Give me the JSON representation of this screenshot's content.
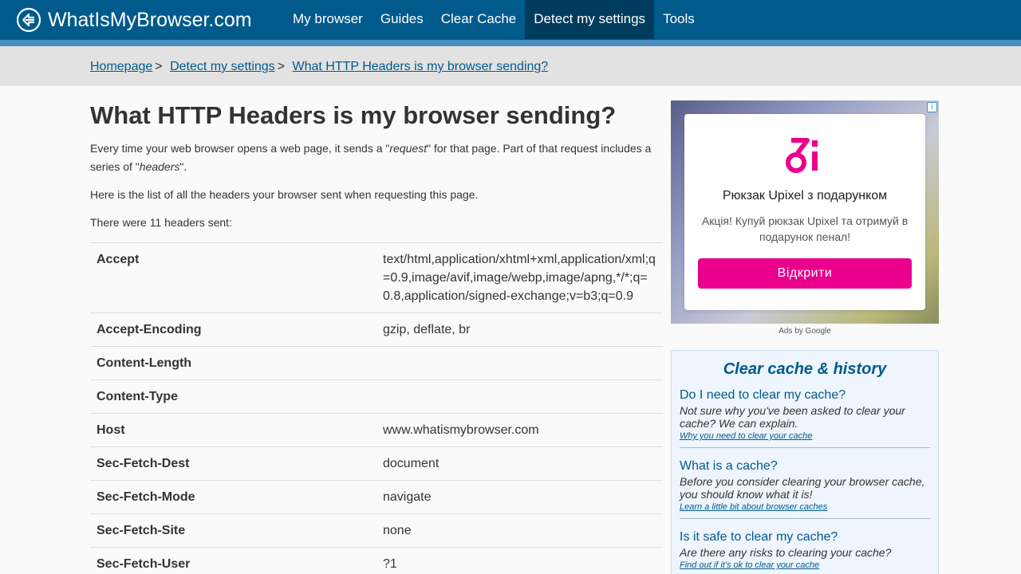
{
  "header": {
    "logo_text": "WhatIsMyBrowser.com",
    "nav": [
      {
        "label": "My browser"
      },
      {
        "label": "Guides"
      },
      {
        "label": "Clear Cache"
      },
      {
        "label": "Detect my settings",
        "active": true
      },
      {
        "label": "Tools"
      }
    ]
  },
  "breadcrumb": {
    "items": [
      "Homepage",
      "Detect my settings",
      "What HTTP Headers is my browser sending?"
    ],
    "separator": ">"
  },
  "main": {
    "title": "What HTTP Headers is my browser sending?",
    "intro_1": "Every time your web browser opens a web page, it sends a \"",
    "intro_em1": "request",
    "intro_2": "\" for that page. Part of that request includes a series of \"",
    "intro_em2": "headers",
    "intro_3": "\".",
    "list_text": "Here is the list of all the headers your browser sent when requesting this page.",
    "count_text": "There were 11 headers sent:",
    "headers": [
      {
        "name": "Accept",
        "value": "text/html,application/xhtml+xml,application/xml;q=0.9,image/avif,image/webp,image/apng,*/*;q=0.8,application/signed-exchange;v=b3;q=0.9"
      },
      {
        "name": "Accept-Encoding",
        "value": "gzip, deflate, br"
      },
      {
        "name": "Content-Length",
        "value": ""
      },
      {
        "name": "Content-Type",
        "value": ""
      },
      {
        "name": "Host",
        "value": "www.whatismybrowser.com"
      },
      {
        "name": "Sec-Fetch-Dest",
        "value": "document"
      },
      {
        "name": "Sec-Fetch-Mode",
        "value": "navigate"
      },
      {
        "name": "Sec-Fetch-Site",
        "value": "none"
      },
      {
        "name": "Sec-Fetch-User",
        "value": "?1"
      }
    ]
  },
  "ad": {
    "title": "Рюкзак Upixel з подарунком",
    "description": "Акція! Купуй рюкзак Upixel та отримуй в подарунок пенал!",
    "button": "Відкрити",
    "info_icon": "i",
    "ads_by": "Ads by Google",
    "brand_color": "#ea008c"
  },
  "cache_box": {
    "title": "Clear cache & history",
    "items": [
      {
        "question": "Do I need to clear my cache?",
        "desc": "Not sure why you've been asked to clear your cache? We can explain.",
        "link": "Why you need to clear your cache"
      },
      {
        "question": "What is a cache?",
        "desc": "Before you consider clearing your browser cache, you should know what it is!",
        "link": "Learn a little bit about browser caches"
      },
      {
        "question": "Is it safe to clear my cache?",
        "desc": "Are there any risks to clearing your cache?",
        "link": "Find out if it's ok to clear your cache"
      }
    ]
  },
  "colors": {
    "nav_bg": "#005a8c",
    "nav_active": "#003c5e",
    "link": "#005a8c"
  }
}
